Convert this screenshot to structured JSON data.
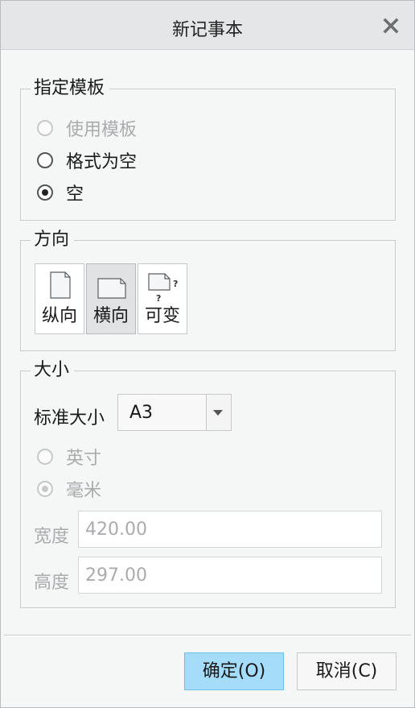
{
  "window": {
    "title": "新记事本",
    "close_icon": "close-icon"
  },
  "template_group": {
    "legend": "指定模板",
    "options": [
      {
        "label": "使用模板",
        "checked": false,
        "disabled": true
      },
      {
        "label": "格式为空",
        "checked": false,
        "disabled": false
      },
      {
        "label": "空",
        "checked": true,
        "disabled": false
      }
    ]
  },
  "orientation_group": {
    "legend": "方向",
    "buttons": [
      {
        "label": "纵向",
        "icon": "portrait-page-icon",
        "active": false
      },
      {
        "label": "横向",
        "icon": "landscape-page-icon",
        "active": true
      },
      {
        "label": "可变",
        "icon": "variable-page-icon",
        "active": false
      }
    ]
  },
  "size_group": {
    "legend": "大小",
    "standard_size_label": "标准大小",
    "standard_size_value": "A3",
    "units": [
      {
        "label": "英寸",
        "checked": false,
        "disabled": true
      },
      {
        "label": "毫米",
        "checked": true,
        "disabled": true
      }
    ],
    "width_label": "宽度",
    "width_value": "420.00",
    "height_label": "高度",
    "height_value": "297.00"
  },
  "buttons": {
    "ok": "确定(O)",
    "cancel": "取消(C)"
  },
  "colors": {
    "primary_button": "#a5dcf9",
    "primary_border": "#6ebfe9",
    "disabled_text": "#a9abad"
  }
}
